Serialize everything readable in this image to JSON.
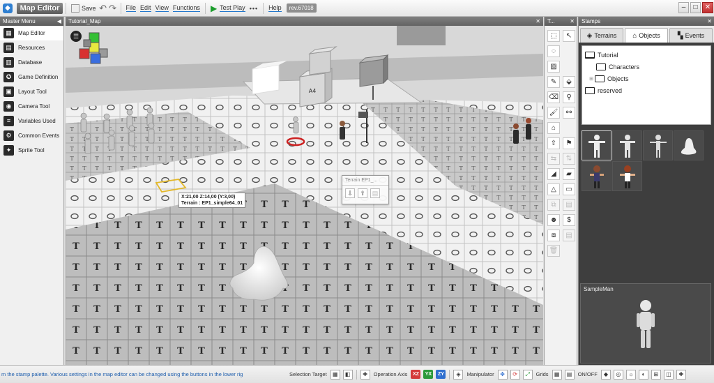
{
  "app": {
    "title": "Map Editor",
    "icons": {
      "app": "app-logo-icon"
    }
  },
  "toolbar": {
    "save_label": "Save",
    "menus": [
      "File",
      "Edit",
      "View",
      "Functions"
    ],
    "test_play_label": "Test Play",
    "more_label": "•••",
    "help_label": "Help",
    "revision": "rev.67018",
    "window_controls": {
      "minimize": "‒",
      "maximize": "□",
      "close": "✕"
    }
  },
  "master_menu": {
    "title": "Master Menu",
    "items": [
      {
        "label": "Map Editor",
        "icon": "map-icon",
        "glyph": "▦"
      },
      {
        "label": "Resources",
        "icon": "resources-icon",
        "glyph": "▤"
      },
      {
        "label": "Database",
        "icon": "database-icon",
        "glyph": "▥"
      },
      {
        "label": "Game Definition",
        "icon": "game-definition-icon",
        "glyph": "✪"
      },
      {
        "label": "Layout Tool",
        "icon": "layout-icon",
        "glyph": "▣"
      },
      {
        "label": "Camera Tool",
        "icon": "camera-icon",
        "glyph": "◉"
      },
      {
        "label": "Variables Used",
        "icon": "variables-icon",
        "glyph": "≡"
      },
      {
        "label": "Common Events",
        "icon": "common-events-icon",
        "glyph": "⚙"
      },
      {
        "label": "Sprite Tool",
        "icon": "sprite-icon",
        "glyph": "✦"
      }
    ]
  },
  "viewport": {
    "tab_title": "Tutorial_Map",
    "coord_line1": "X:21,00 Z:14,00 (Y:3,00)",
    "coord_line2": "Terrain : EP1_simple64_01",
    "terrain_popup_title": "Terrain EP1_...",
    "cube_label": "A4",
    "colors": {
      "floor_light": "#f2f2f2",
      "floor_dark": "#bdbdbd",
      "sky": "#d6d6d6"
    }
  },
  "tools_panel": {
    "title": "T...",
    "tools": [
      {
        "name": "select-tool-icon",
        "glyph": "⬚",
        "dim": false
      },
      {
        "name": "pointer-tool-icon",
        "glyph": "↖",
        "dim": false
      },
      {
        "name": "lasso-tool-icon",
        "glyph": "◌",
        "dim": false
      },
      {
        "name": "blank",
        "glyph": "",
        "dim": false
      },
      {
        "name": "box-tool-icon",
        "glyph": "▨",
        "dim": false
      },
      {
        "name": "blank",
        "glyph": "",
        "dim": false
      },
      {
        "name": "pencil-tool-icon",
        "glyph": "✎",
        "dim": false
      },
      {
        "name": "bucket-tool-icon",
        "glyph": "⬙",
        "dim": false
      },
      {
        "name": "eraser-tool-icon",
        "glyph": "⌫",
        "dim": false
      },
      {
        "name": "eyedropper-tool-icon",
        "glyph": "⚲",
        "dim": false
      },
      {
        "name": "paint-tool-icon",
        "glyph": "🖌",
        "dim": false
      },
      {
        "name": "link-tool-icon",
        "glyph": "⚯",
        "dim": false
      },
      {
        "name": "house-tool-icon",
        "glyph": "⌂",
        "dim": false
      },
      {
        "name": "blank",
        "glyph": "",
        "dim": false
      },
      {
        "name": "raise-tool-icon",
        "glyph": "⇧",
        "dim": false
      },
      {
        "name": "pin-tool-icon",
        "glyph": "⚑",
        "dim": false
      },
      {
        "name": "flip-h-tool-icon",
        "glyph": "⇆",
        "dim": true
      },
      {
        "name": "flip-v-tool-icon",
        "glyph": "⇅",
        "dim": true
      },
      {
        "name": "slope-tool-icon",
        "glyph": "◢",
        "dim": false
      },
      {
        "name": "ramp-tool-icon",
        "glyph": "▰",
        "dim": false
      },
      {
        "name": "triangle-tool-icon",
        "glyph": "△",
        "dim": false
      },
      {
        "name": "wall-tool-icon",
        "glyph": "▭",
        "dim": false
      },
      {
        "name": "copy-tool-icon",
        "glyph": "⧉",
        "dim": true
      },
      {
        "name": "paste-tool-icon",
        "glyph": "▤",
        "dim": true
      },
      {
        "name": "character-tool-icon",
        "glyph": "☻",
        "dim": false
      },
      {
        "name": "coin-tool-icon",
        "glyph": "$",
        "dim": false
      },
      {
        "name": "duplicate-tool-icon",
        "glyph": "⧈",
        "dim": false
      },
      {
        "name": "paste2-tool-icon",
        "glyph": "▤",
        "dim": true
      },
      {
        "name": "trash-tool-icon",
        "glyph": "🗑",
        "dim": true
      }
    ]
  },
  "stamps": {
    "title": "Stamps",
    "tabs": [
      {
        "label": "Terrains",
        "icon": "cube-icon",
        "glyph": "◈"
      },
      {
        "label": "Objects",
        "icon": "house-icon",
        "glyph": "⌂"
      },
      {
        "label": "Events",
        "icon": "events-icon",
        "glyph": "▚"
      }
    ],
    "tree": {
      "root": "Tutorial",
      "children": [
        "Characters",
        "Objects"
      ],
      "sibling": "reserved"
    },
    "preview_label": "SampleMan"
  },
  "statusbar": {
    "message": "m the stamp palette.  Various settings in the map editor can be changed using the buttons in the lower rig",
    "selection_target": "Selection Target",
    "operation_axis": "Operation Axis",
    "axes": [
      {
        "label": "XZ",
        "color": "#d43a3a"
      },
      {
        "label": "YX",
        "color": "#2c9a3a"
      },
      {
        "label": "ZY",
        "color": "#2f6fcf"
      }
    ],
    "manipulator": "Manipulator",
    "grids": "Grids",
    "on_off": "ON/OFF"
  }
}
